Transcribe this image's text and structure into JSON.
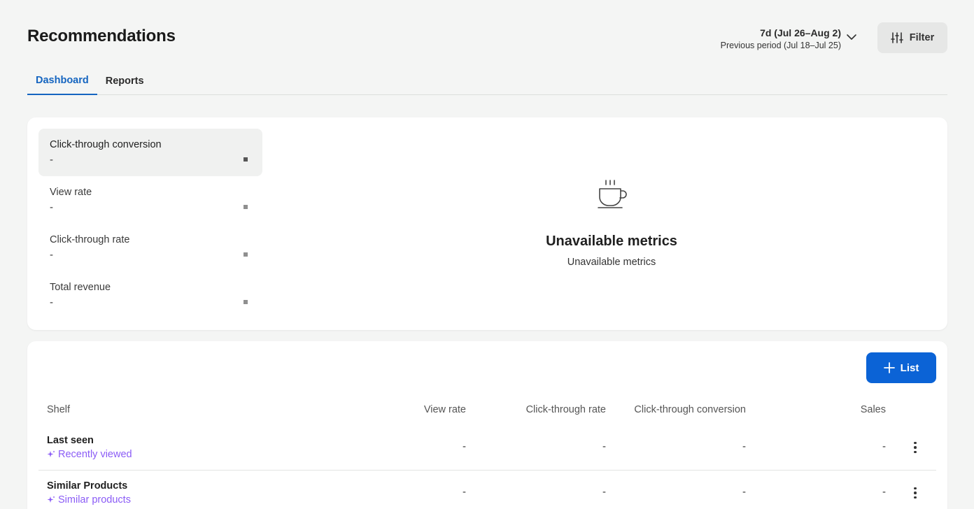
{
  "header": {
    "title": "Recommendations",
    "period_main": "7d (Jul 26–Aug 2)",
    "period_sub": "Previous period (Jul 18–Jul 25)",
    "filter_label": "Filter"
  },
  "tabs": [
    {
      "label": "Dashboard",
      "active": true
    },
    {
      "label": "Reports",
      "active": false
    }
  ],
  "metrics": [
    {
      "label": "Click-through conversion",
      "value": "-",
      "selected": true
    },
    {
      "label": "View rate",
      "value": "-",
      "selected": false
    },
    {
      "label": "Click-through rate",
      "value": "-",
      "selected": false
    },
    {
      "label": "Total revenue",
      "value": "-",
      "selected": false
    }
  ],
  "empty_state": {
    "icon": "coffee-cup-icon",
    "title": "Unavailable metrics",
    "subtitle": "Unavailable metrics"
  },
  "table": {
    "add_button_label": "List",
    "columns": [
      "Shelf",
      "View rate",
      "Click-through rate",
      "Click-through conversion",
      "Sales"
    ],
    "rows": [
      {
        "title": "Last seen",
        "subtitle": "Recently viewed",
        "view_rate": "-",
        "ctr": "-",
        "ctc": "-",
        "sales": "-"
      },
      {
        "title": "Similar Products",
        "subtitle": "Similar products",
        "view_rate": "-",
        "ctr": "-",
        "ctc": "-",
        "sales": "-"
      }
    ]
  },
  "colors": {
    "accent": "#0b63d6",
    "tab_active": "#1565c0",
    "subtitle_purple": "#8b5cf6",
    "background": "#f4f5f4"
  }
}
